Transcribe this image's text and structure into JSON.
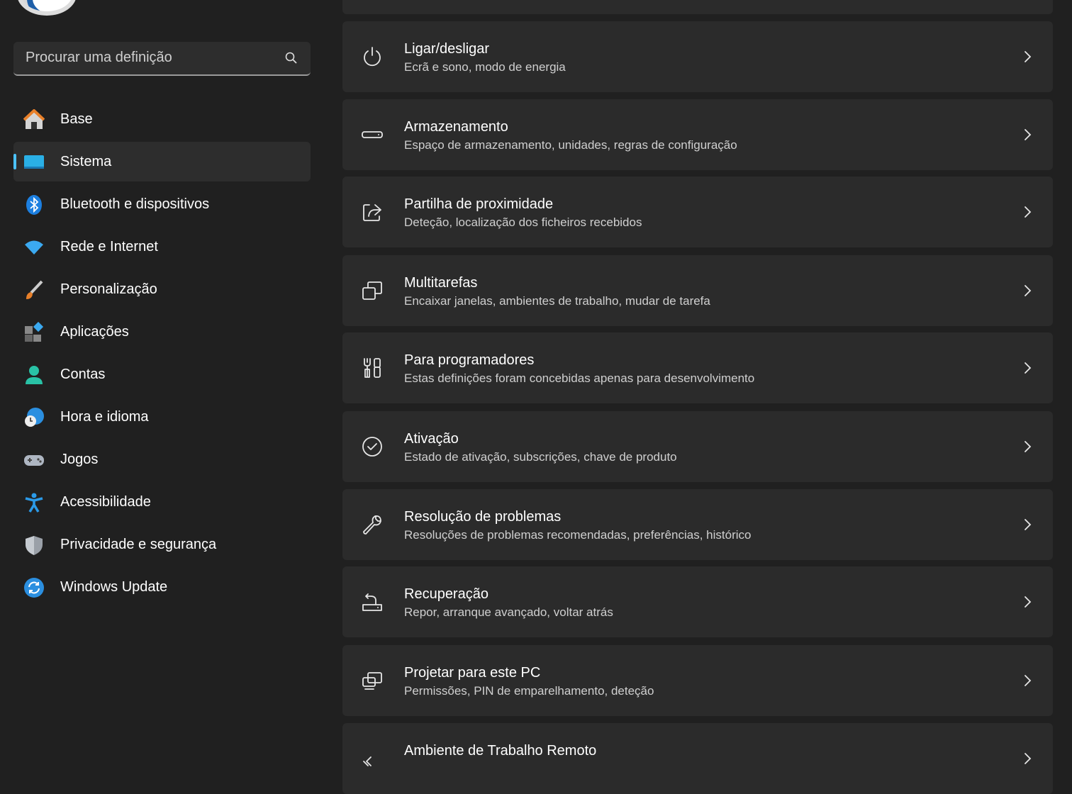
{
  "search": {
    "placeholder": "Procurar uma definição"
  },
  "accent": "#4cc2ff",
  "nav": [
    {
      "label": "Base",
      "icon": "home-icon"
    },
    {
      "label": "Sistema",
      "icon": "monitor-icon",
      "active": true
    },
    {
      "label": "Bluetooth e dispositivos",
      "icon": "bluetooth-icon"
    },
    {
      "label": "Rede e Internet",
      "icon": "wifi-icon"
    },
    {
      "label": "Personalização",
      "icon": "brush-icon"
    },
    {
      "label": "Aplicações",
      "icon": "apps-icon"
    },
    {
      "label": "Contas",
      "icon": "person-icon"
    },
    {
      "label": "Hora e idioma",
      "icon": "globe-clock-icon"
    },
    {
      "label": "Jogos",
      "icon": "gamepad-icon"
    },
    {
      "label": "Acessibilidade",
      "icon": "accessibility-icon"
    },
    {
      "label": "Privacidade e segurança",
      "icon": "shield-icon"
    },
    {
      "label": "Windows Update",
      "icon": "update-icon"
    }
  ],
  "cards": [
    {
      "title": "Ligar/desligar",
      "subtitle": "Ecrã e sono, modo de energia",
      "icon": "power-icon"
    },
    {
      "title": "Armazenamento",
      "subtitle": "Espaço de armazenamento, unidades, regras de configuração",
      "icon": "storage-icon"
    },
    {
      "title": "Partilha de proximidade",
      "subtitle": "Deteção, localização dos ficheiros recebidos",
      "icon": "share-icon"
    },
    {
      "title": "Multitarefas",
      "subtitle": "Encaixar janelas, ambientes de trabalho, mudar de tarefa",
      "icon": "multitask-icon"
    },
    {
      "title": "Para programadores",
      "subtitle": "Estas definições foram concebidas apenas para desenvolvimento",
      "icon": "developer-tools-icon"
    },
    {
      "title": "Ativação",
      "subtitle": "Estado de ativação, subscrições, chave de produto",
      "icon": "check-circle-icon"
    },
    {
      "title": "Resolução de problemas",
      "subtitle": "Resoluções de problemas recomendadas, preferências, histórico",
      "icon": "wrench-icon"
    },
    {
      "title": "Recuperação",
      "subtitle": "Repor, arranque avançado, voltar atrás",
      "icon": "recovery-icon"
    },
    {
      "title": "Projetar para este PC",
      "subtitle": "Permissões, PIN de emparelhamento, deteção",
      "icon": "project-icon"
    },
    {
      "title": "Ambiente de Trabalho Remoto",
      "subtitle": "",
      "icon": "remote-desktop-icon"
    }
  ]
}
